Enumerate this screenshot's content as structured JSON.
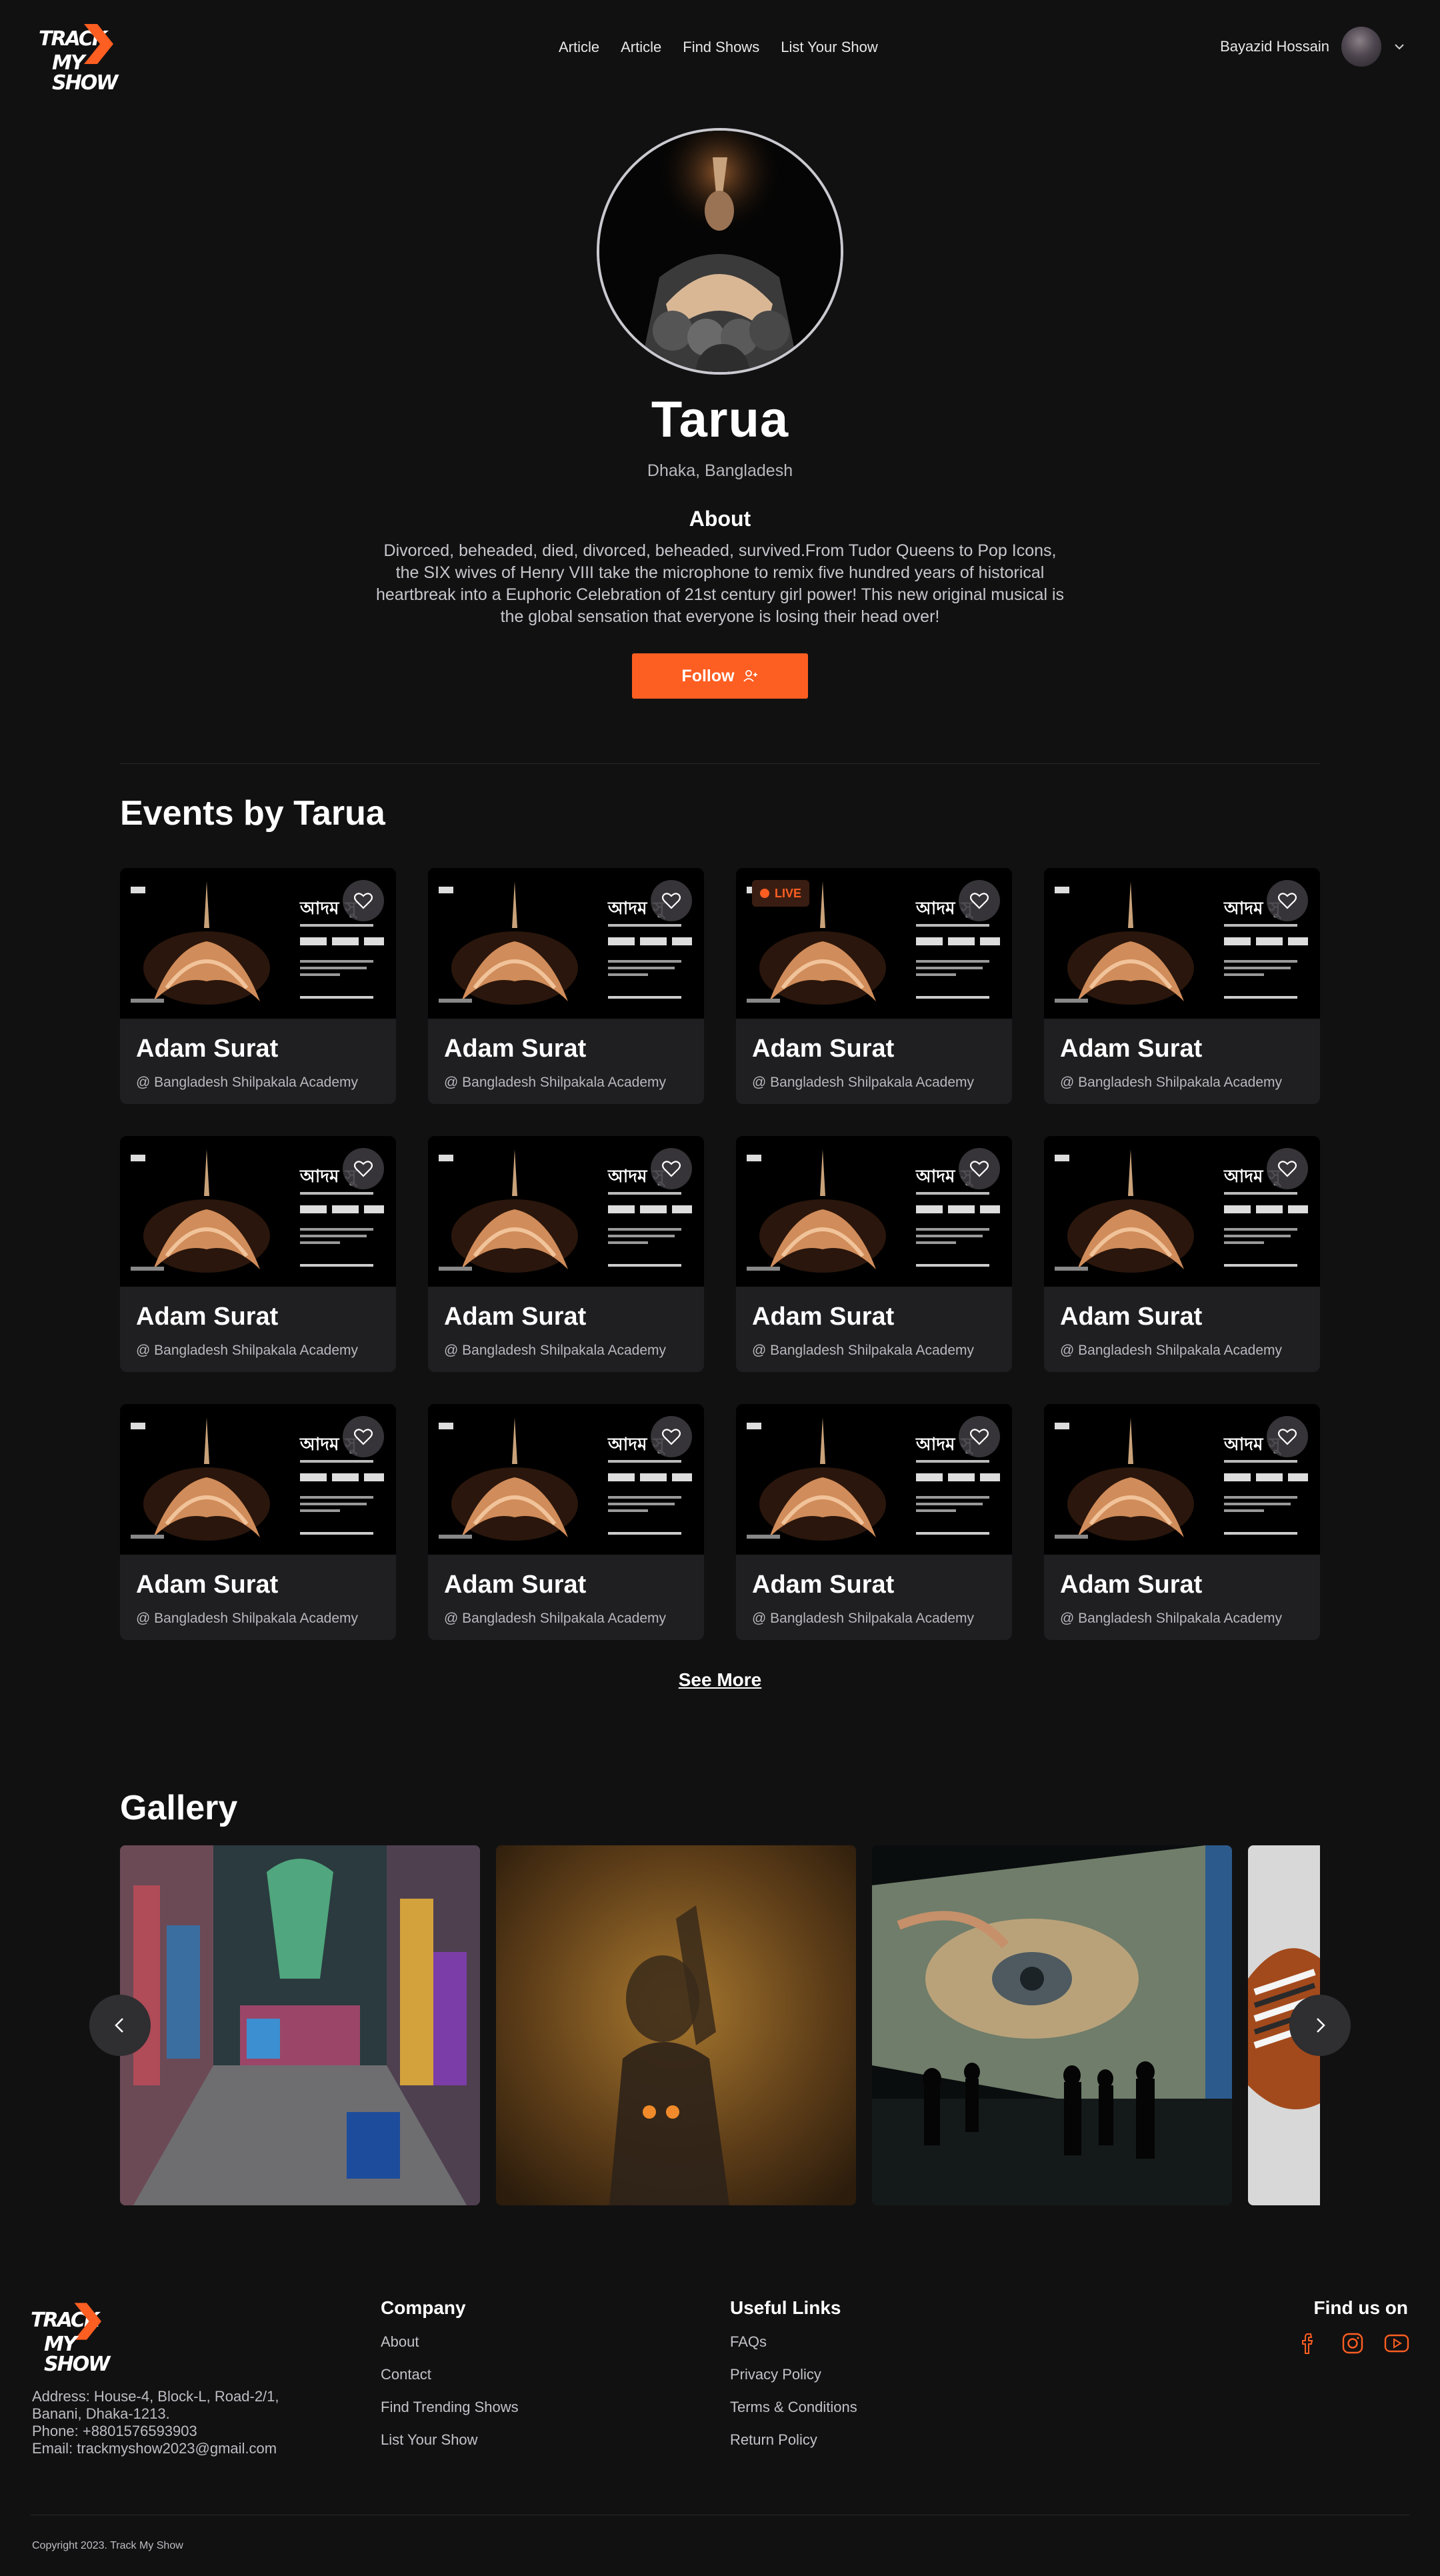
{
  "header": {
    "logo_top": "TRACK",
    "logo_bottom": "MY SHOW",
    "nav": [
      "Article",
      "Article",
      "Find Shows",
      "List Your Show"
    ],
    "user_name": "Bayazid Hossain"
  },
  "profile": {
    "name": "Tarua",
    "location": "Dhaka, Bangladesh",
    "about_title": "About",
    "about_text": "Divorced, beheaded, died, divorced, beheaded, survived.From Tudor Queens to Pop Icons, the SIX wives of Henry VIII take the microphone to remix five hundred years of historical heartbreak into a Euphoric Celebration of 21st century girl power! This new original musical is the global sensation that everyone is losing their head over!",
    "follow_label": "Follow"
  },
  "events": {
    "title": "Events by Tarua",
    "cards": [
      {
        "title": "Adam Surat",
        "venue": "@ Bangladesh Shilpakala Academy",
        "live": false
      },
      {
        "title": "Adam Surat",
        "venue": "@ Bangladesh Shilpakala Academy",
        "live": false
      },
      {
        "title": "Adam Surat",
        "venue": "@ Bangladesh Shilpakala Academy",
        "live": true
      },
      {
        "title": "Adam Surat",
        "venue": "@ Bangladesh Shilpakala Academy",
        "live": false
      },
      {
        "title": "Adam Surat",
        "venue": "@ Bangladesh Shilpakala Academy",
        "live": false
      },
      {
        "title": "Adam Surat",
        "venue": "@ Bangladesh Shilpakala Academy",
        "live": false
      },
      {
        "title": "Adam Surat",
        "venue": "@ Bangladesh Shilpakala Academy",
        "live": false
      },
      {
        "title": "Adam Surat",
        "venue": "@ Bangladesh Shilpakala Academy",
        "live": false
      },
      {
        "title": "Adam Surat",
        "venue": "@ Bangladesh Shilpakala Academy",
        "live": false
      },
      {
        "title": "Adam Surat",
        "venue": "@ Bangladesh Shilpakala Academy",
        "live": false
      },
      {
        "title": "Adam Surat",
        "venue": "@ Bangladesh Shilpakala Academy",
        "live": false
      },
      {
        "title": "Adam Surat",
        "venue": "@ Bangladesh Shilpakala Academy",
        "live": false
      }
    ],
    "live_label": "LIVE",
    "poster_title": "আদম সু",
    "see_more": "See More"
  },
  "gallery": {
    "title": "Gallery",
    "images": [
      "graffiti-alley",
      "silhouette-behind-glass",
      "immersive-art-exhibition",
      "patterned-fabric"
    ]
  },
  "footer": {
    "address_lines": [
      "Address: House-4, Block-L, Road-2/1,",
      "Banani, Dhaka-1213.",
      "Phone:  +8801576593903",
      "Email:  trackmyshow2023@gmail.com"
    ],
    "company": {
      "title": "Company",
      "links": [
        "About",
        "Contact",
        "Find Trending Shows",
        "List Your Show"
      ]
    },
    "useful": {
      "title": "Useful Links",
      "links": [
        "FAQs",
        "Privacy Policy",
        "Terms & Conditions",
        "Return Policy"
      ]
    },
    "find_us": "Find us on",
    "socials": [
      "facebook-icon",
      "instagram-icon",
      "youtube-icon"
    ],
    "copyright": "Copyright 2023. Track My Show"
  },
  "colors": {
    "background": "#121112",
    "accent": "#fd5e21",
    "card": "#1f1e20"
  }
}
